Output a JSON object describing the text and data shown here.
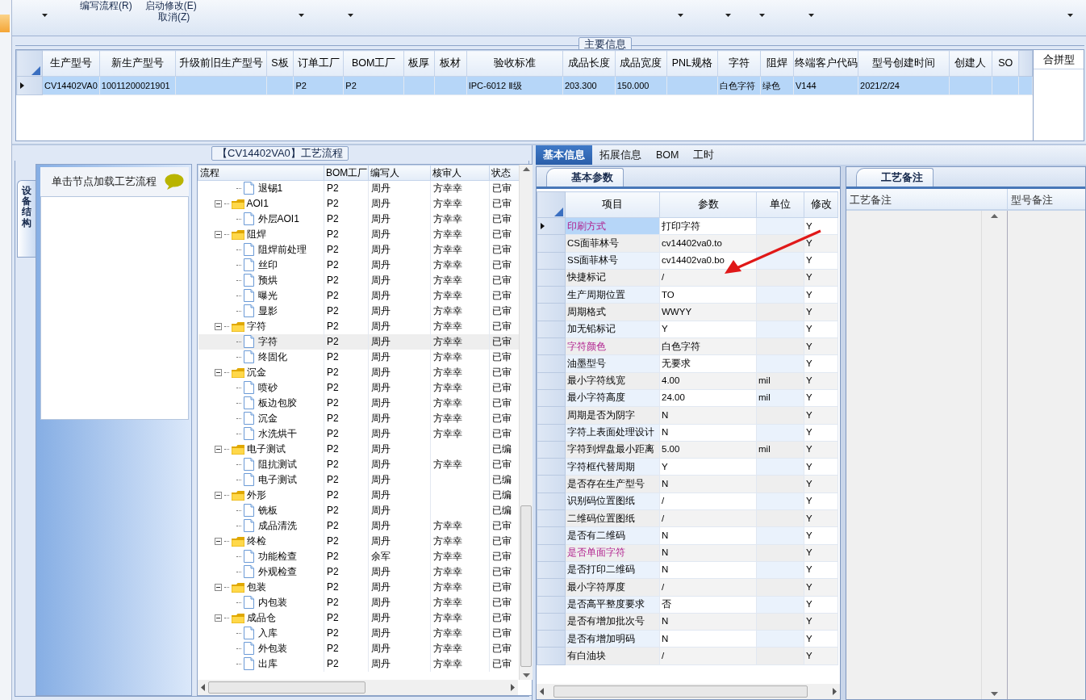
{
  "toolbar": {
    "commands": [
      "编写流程(R)",
      "启动修改(E)",
      "取消(Z)"
    ]
  },
  "main_info": {
    "title": "主要信息",
    "columns": [
      "生产型号",
      "新生产型号",
      "升级前旧生产型号",
      "S板",
      "订单工厂",
      "BOM工厂",
      "板厚",
      "板材",
      "验收标准",
      "成品长度",
      "成品宽度",
      "PNL规格",
      "字符",
      "阻焊",
      "终端客户代码",
      "型号创建时间",
      "创建人",
      "SO"
    ],
    "rows": [
      {
        "selected": true,
        "cells": [
          "CV14402VA0",
          "10011200021901",
          null,
          null,
          "P2",
          "P2",
          null,
          null,
          "IPC-6012 Ⅱ级",
          "203.300",
          "150.000",
          null,
          "白色字符",
          "绿色",
          "V144",
          "2021/2/24",
          null,
          null
        ]
      }
    ],
    "side_panel": {
      "title": "合拼型"
    }
  },
  "process": {
    "title": "【CV14402VA0】工艺流程",
    "side_tab": "设备结构",
    "hint": "单击节点加载工艺流程",
    "columns": [
      "流程",
      "BOM工厂",
      "编写人",
      "核审人",
      "状态"
    ],
    "continued_rows": [
      {
        "name": "退锡1",
        "bom": "P2",
        "writer": "周丹",
        "reviewer": "方幸幸",
        "status": "已审",
        "selected": false
      }
    ],
    "nodes": [
      {
        "name": "AOI1",
        "bom": "P2",
        "writer": "周丹",
        "reviewer": "方幸幸",
        "status": "已审",
        "selected": false,
        "expanded": true,
        "children": [
          {
            "name": "外层AOI1",
            "bom": "P2",
            "writer": "周丹",
            "reviewer": "方幸幸",
            "status": "已审",
            "selected": false
          }
        ]
      },
      {
        "name": "阻焊",
        "bom": "P2",
        "writer": "周丹",
        "reviewer": "方幸幸",
        "status": "已审",
        "selected": false,
        "expanded": true,
        "children": [
          {
            "name": "阻焊前处理",
            "bom": "P2",
            "writer": "周丹",
            "reviewer": "方幸幸",
            "status": "已审",
            "selected": false
          },
          {
            "name": "丝印",
            "bom": "P2",
            "writer": "周丹",
            "reviewer": "方幸幸",
            "status": "已审",
            "selected": false
          },
          {
            "name": "预烘",
            "bom": "P2",
            "writer": "周丹",
            "reviewer": "方幸幸",
            "status": "已审",
            "selected": false
          },
          {
            "name": "曝光",
            "bom": "P2",
            "writer": "周丹",
            "reviewer": "方幸幸",
            "status": "已审",
            "selected": false
          },
          {
            "name": "显影",
            "bom": "P2",
            "writer": "周丹",
            "reviewer": "方幸幸",
            "status": "已审",
            "selected": false
          }
        ]
      },
      {
        "name": "字符",
        "bom": "P2",
        "writer": "周丹",
        "reviewer": "方幸幸",
        "status": "已审",
        "selected": false,
        "expanded": true,
        "children": [
          {
            "name": "字符",
            "bom": "P2",
            "writer": "周丹",
            "reviewer": "方幸幸",
            "status": "已审",
            "selected": true
          },
          {
            "name": "终固化",
            "bom": "P2",
            "writer": "周丹",
            "reviewer": "方幸幸",
            "status": "已审",
            "selected": false
          }
        ]
      },
      {
        "name": "沉金",
        "bom": "P2",
        "writer": "周丹",
        "reviewer": "方幸幸",
        "status": "已审",
        "selected": false,
        "expanded": true,
        "children": [
          {
            "name": "喷砂",
            "bom": "P2",
            "writer": "周丹",
            "reviewer": "方幸幸",
            "status": "已审",
            "selected": false
          },
          {
            "name": "板边包胶",
            "bom": "P2",
            "writer": "周丹",
            "reviewer": "方幸幸",
            "status": "已审",
            "selected": false
          },
          {
            "name": "沉金",
            "bom": "P2",
            "writer": "周丹",
            "reviewer": "方幸幸",
            "status": "已审",
            "selected": false
          },
          {
            "name": "水洗烘干",
            "bom": "P2",
            "writer": "周丹",
            "reviewer": "方幸幸",
            "status": "已审",
            "selected": false
          }
        ]
      },
      {
        "name": "电子测试",
        "bom": "P2",
        "writer": "周丹",
        "status": "已编",
        "selected": false,
        "expanded": true,
        "children": [
          {
            "name": "阻抗测试",
            "bom": "P2",
            "writer": "周丹",
            "reviewer": "方幸幸",
            "status": "已审",
            "selected": false
          },
          {
            "name": "电子测试",
            "bom": "P2",
            "writer": "周丹",
            "status": "已编",
            "selected": false
          }
        ]
      },
      {
        "name": "外形",
        "bom": "P2",
        "writer": "周丹",
        "status": "已编",
        "selected": false,
        "expanded": true,
        "children": [
          {
            "name": "铣板",
            "bom": "P2",
            "writer": "周丹",
            "status": "已编",
            "selected": false
          },
          {
            "name": "成品清洗",
            "bom": "P2",
            "writer": "周丹",
            "reviewer": "方幸幸",
            "status": "已审",
            "selected": false
          }
        ]
      },
      {
        "name": "终检",
        "bom": "P2",
        "writer": "周丹",
        "reviewer": "方幸幸",
        "status": "已审",
        "selected": false,
        "expanded": true,
        "children": [
          {
            "name": "功能检查",
            "bom": "P2",
            "writer": "余军",
            "reviewer": "方幸幸",
            "status": "已审",
            "selected": false
          },
          {
            "name": "外观检查",
            "bom": "P2",
            "writer": "周丹",
            "reviewer": "方幸幸",
            "status": "已审",
            "selected": false
          }
        ]
      },
      {
        "name": "包装",
        "bom": "P2",
        "writer": "周丹",
        "reviewer": "方幸幸",
        "status": "已审",
        "selected": false,
        "expanded": true,
        "children": [
          {
            "name": "内包装",
            "bom": "P2",
            "writer": "周丹",
            "reviewer": "方幸幸",
            "status": "已审",
            "selected": false
          }
        ]
      },
      {
        "name": "成品仓",
        "bom": "P2",
        "writer": "周丹",
        "reviewer": "方幸幸",
        "status": "已审",
        "selected": false,
        "expanded": true,
        "children": [
          {
            "name": "入库",
            "bom": "P2",
            "writer": "周丹",
            "reviewer": "方幸幸",
            "status": "已审",
            "selected": false
          },
          {
            "name": "外包装",
            "bom": "P2",
            "writer": "周丹",
            "reviewer": "方幸幸",
            "status": "已审",
            "selected": false
          },
          {
            "name": "出库",
            "bom": "P2",
            "writer": "周丹",
            "reviewer": "方幸幸",
            "status": "已审",
            "selected": false
          }
        ]
      }
    ]
  },
  "tabs": [
    {
      "label": "基本信息",
      "selected": true
    },
    {
      "label": "拓展信息",
      "selected": false
    },
    {
      "label": "BOM",
      "selected": false
    },
    {
      "label": "工时",
      "selected": false
    }
  ],
  "params": {
    "tab": "基本参数",
    "columns": [
      "项目",
      "参数",
      "单位",
      "修改"
    ],
    "rows": [
      {
        "item": "印刷方式",
        "value": "打印字符",
        "modified": "Y",
        "marked": true,
        "selected": true
      },
      {
        "item": "CS面菲林号",
        "value": "cv14402va0.to",
        "modified": "Y",
        "marked": false,
        "selected": false
      },
      {
        "item": "SS面菲林号",
        "value": "cv14402va0.bo",
        "modified": "Y",
        "marked": false,
        "selected": false
      },
      {
        "item": "快捷标记",
        "value": "/",
        "modified": "Y",
        "marked": false,
        "selected": false
      },
      {
        "item": "生产周期位置",
        "value": "TO",
        "modified": "Y",
        "marked": false,
        "selected": false
      },
      {
        "item": "周期格式",
        "value": "WWYY",
        "modified": "Y",
        "marked": false,
        "selected": false
      },
      {
        "item": "加无铅标记",
        "value": "Y",
        "modified": "Y",
        "marked": false,
        "selected": false
      },
      {
        "item": "字符颜色",
        "value": "白色字符",
        "modified": "Y",
        "marked": true,
        "selected": false
      },
      {
        "item": "油墨型号",
        "value": "无要求",
        "modified": "Y",
        "marked": false,
        "selected": false
      },
      {
        "item": "最小字符线宽",
        "value": "4.00",
        "unit": "mil",
        "modified": "Y",
        "marked": false,
        "selected": false
      },
      {
        "item": "最小字符高度",
        "value": "24.00",
        "unit": "mil",
        "modified": "Y",
        "marked": false,
        "selected": false
      },
      {
        "item": "周期是否为阴字",
        "value": "N",
        "modified": "Y",
        "marked": false,
        "selected": false
      },
      {
        "item": "字符上表面处理设计",
        "value": "N",
        "modified": "Y",
        "marked": false,
        "selected": false
      },
      {
        "item": "字符到焊盘最小距离",
        "value": "5.00",
        "unit": "mil",
        "modified": "Y",
        "marked": false,
        "selected": false
      },
      {
        "item": "字符框代替周期",
        "value": "Y",
        "modified": "Y",
        "marked": false,
        "selected": false
      },
      {
        "item": "是否存在生产型号",
        "value": "N",
        "modified": "Y",
        "marked": false,
        "selected": false
      },
      {
        "item": "识别码位置图纸",
        "value": "/",
        "modified": "Y",
        "marked": false,
        "selected": false
      },
      {
        "item": "二维码位置图纸",
        "value": "/",
        "modified": "Y",
        "marked": false,
        "selected": false
      },
      {
        "item": "是否有二维码",
        "value": "N",
        "modified": "Y",
        "marked": false,
        "selected": false
      },
      {
        "item": "是否单面字符",
        "value": "N",
        "modified": "Y",
        "marked": true,
        "selected": false
      },
      {
        "item": "是否打印二维码",
        "value": "N",
        "modified": "Y",
        "marked": false,
        "selected": false
      },
      {
        "item": "最小字符厚度",
        "value": "/",
        "modified": "Y",
        "marked": false,
        "selected": false
      },
      {
        "item": "是否高平整度要求",
        "value": "否",
        "modified": "Y",
        "marked": false,
        "selected": false
      },
      {
        "item": "是否有增加批次号",
        "value": "N",
        "modified": "Y",
        "marked": false,
        "selected": false
      },
      {
        "item": "是否有增加明码",
        "value": "N",
        "modified": "Y",
        "marked": false,
        "selected": false
      },
      {
        "item": "有白油块",
        "value": "/",
        "modified": "Y",
        "marked": false,
        "selected": false
      }
    ]
  },
  "notes": {
    "tab": "工艺备注",
    "columns": [
      "工艺备注",
      "型号备注"
    ]
  }
}
